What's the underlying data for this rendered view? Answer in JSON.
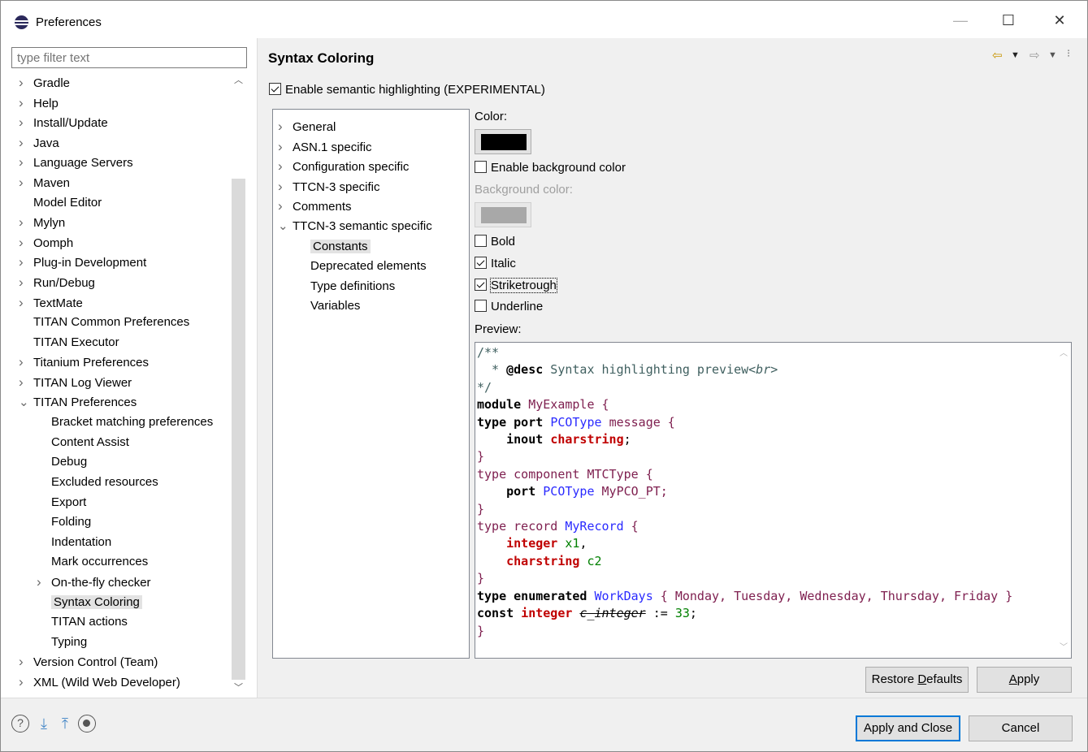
{
  "window": {
    "title": "Preferences",
    "minimize": "—",
    "maximize": "☐",
    "close": "✕"
  },
  "left": {
    "filter_placeholder": "type filter text",
    "items": [
      {
        "label": "Gradle",
        "twisty": ">",
        "indent": 0
      },
      {
        "label": "Help",
        "twisty": ">",
        "indent": 0
      },
      {
        "label": "Install/Update",
        "twisty": ">",
        "indent": 0
      },
      {
        "label": "Java",
        "twisty": ">",
        "indent": 0
      },
      {
        "label": "Language Servers",
        "twisty": ">",
        "indent": 0
      },
      {
        "label": "Maven",
        "twisty": ">",
        "indent": 0
      },
      {
        "label": "Model Editor",
        "twisty": "",
        "indent": 0
      },
      {
        "label": "Mylyn",
        "twisty": ">",
        "indent": 0
      },
      {
        "label": "Oomph",
        "twisty": ">",
        "indent": 0
      },
      {
        "label": "Plug-in Development",
        "twisty": ">",
        "indent": 0
      },
      {
        "label": "Run/Debug",
        "twisty": ">",
        "indent": 0
      },
      {
        "label": "TextMate",
        "twisty": ">",
        "indent": 0
      },
      {
        "label": "TITAN Common Preferences",
        "twisty": "",
        "indent": 0
      },
      {
        "label": "TITAN Executor",
        "twisty": "",
        "indent": 0
      },
      {
        "label": "Titanium Preferences",
        "twisty": ">",
        "indent": 0
      },
      {
        "label": "TITAN Log Viewer",
        "twisty": ">",
        "indent": 0
      },
      {
        "label": "TITAN Preferences",
        "twisty": "v",
        "indent": 0
      },
      {
        "label": "Bracket matching preferences",
        "twisty": "",
        "indent": 1
      },
      {
        "label": "Content Assist",
        "twisty": "",
        "indent": 1
      },
      {
        "label": "Debug",
        "twisty": "",
        "indent": 1
      },
      {
        "label": "Excluded resources",
        "twisty": "",
        "indent": 1
      },
      {
        "label": "Export",
        "twisty": "",
        "indent": 1
      },
      {
        "label": "Folding",
        "twisty": "",
        "indent": 1
      },
      {
        "label": "Indentation",
        "twisty": "",
        "indent": 1
      },
      {
        "label": "Mark occurrences",
        "twisty": "",
        "indent": 1
      },
      {
        "label": "On-the-fly checker",
        "twisty": ">",
        "indent": 1
      },
      {
        "label": "Syntax Coloring",
        "twisty": "",
        "indent": 1,
        "selected": true
      },
      {
        "label": "TITAN actions",
        "twisty": "",
        "indent": 1
      },
      {
        "label": "Typing",
        "twisty": "",
        "indent": 1
      },
      {
        "label": "Version Control (Team)",
        "twisty": ">",
        "indent": 0
      },
      {
        "label": "XML (Wild Web Developer)",
        "twisty": ">",
        "indent": 0
      }
    ]
  },
  "page": {
    "title": "Syntax Coloring",
    "semantic_highlighting": "Enable semantic highlighting (EXPERIMENTAL)",
    "categories": [
      {
        "label": "General",
        "twisty": ">",
        "indent": 0
      },
      {
        "label": "ASN.1 specific",
        "twisty": ">",
        "indent": 0
      },
      {
        "label": "Configuration specific",
        "twisty": ">",
        "indent": 0
      },
      {
        "label": "TTCN-3 specific",
        "twisty": ">",
        "indent": 0
      },
      {
        "label": "Comments",
        "twisty": ">",
        "indent": 0
      },
      {
        "label": "TTCN-3 semantic specific",
        "twisty": "v",
        "indent": 0
      },
      {
        "label": "Constants",
        "twisty": "",
        "indent": 1,
        "selected": true
      },
      {
        "label": "Deprecated elements",
        "twisty": "",
        "indent": 1
      },
      {
        "label": "Type definitions",
        "twisty": "",
        "indent": 1
      },
      {
        "label": "Variables",
        "twisty": "",
        "indent": 1
      }
    ],
    "color_label": "Color:",
    "color_value": "#000000",
    "enable_bg": "Enable background color",
    "bg_label": "Background color:",
    "bg_value": "#a8a8a8",
    "bold": "Bold",
    "italic": "Italic",
    "strikethrough": "Striketrough",
    "underline": "Underline",
    "preview_label": "Preview:"
  },
  "buttons": {
    "restore_pre": "Restore ",
    "restore_mn": "D",
    "restore_post": "efaults",
    "apply_mn": "A",
    "apply_post": "pply",
    "apply_close": "Apply and Close",
    "cancel": "Cancel"
  },
  "colors": {
    "accent": "#0078d7",
    "selection": "#e3e3e3",
    "keyword_type": "#7f0055",
    "type_name": "#2a2aff",
    "builtin": "#c00000",
    "identifier": "#008000"
  }
}
